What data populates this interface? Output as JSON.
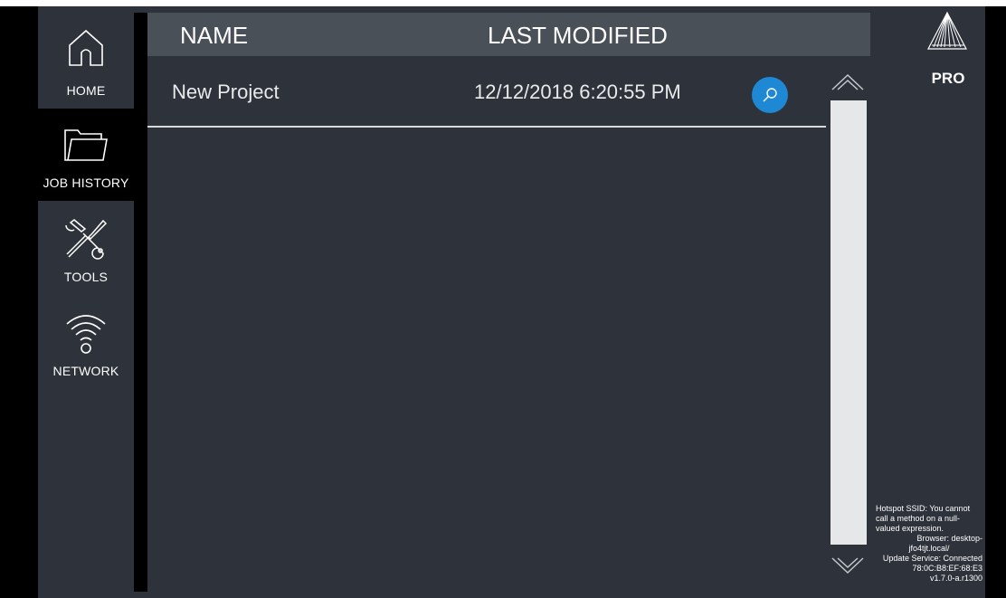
{
  "nav": {
    "items": [
      {
        "label": "HOME",
        "icon": "home-icon"
      },
      {
        "label": "JOB HISTORY",
        "icon": "folder-icon",
        "active": true
      },
      {
        "label": "TOOLS",
        "icon": "tools-icon"
      },
      {
        "label": "NETWORK",
        "icon": "wifi-icon"
      }
    ]
  },
  "table": {
    "headers": {
      "name": "NAME",
      "last_modified": "LAST MODIFIED"
    },
    "rows": [
      {
        "name": "New Project",
        "last_modified": "12/12/2018 6:20:55 PM",
        "action_icon": "search-icon"
      }
    ]
  },
  "scrollbar": {
    "up_icon": "chevron-up-icon",
    "down_icon": "chevron-down-icon"
  },
  "brand": {
    "logo_icon": "prism-logo-icon",
    "edition": "PRO"
  },
  "status": {
    "hotspot_line1": "Hotspot SSID: You cannot",
    "hotspot_line2": "call a method on a null-",
    "hotspot_line3": "valued expression.",
    "browser_line1": "Browser: desktop-",
    "browser_line2": "jfo4tjt.local/",
    "update_service": "Update Service: Connected",
    "mac": "78:0C:B8:EF:68:E3",
    "version": "v1.7.0-a.r1300"
  },
  "colors": {
    "accent": "#1e88d4",
    "background": "#2d323b",
    "header": "#4a5058",
    "scroll_track": "#e6e7e8"
  }
}
